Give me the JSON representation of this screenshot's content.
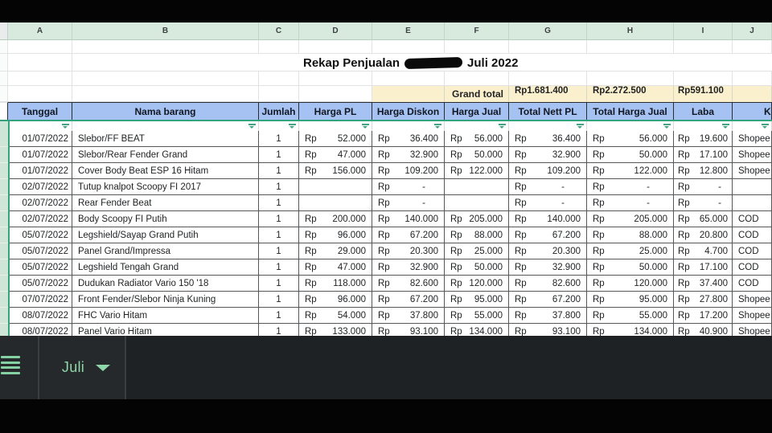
{
  "sheet": {
    "column_letters": [
      "A",
      "B",
      "C",
      "D",
      "E",
      "F",
      "G",
      "H",
      "I",
      "J"
    ],
    "title_prefix": "Rekap Penjualan",
    "title_suffix": "Juli 2022",
    "currency": "Rp",
    "grand_total": {
      "label": "Grand total",
      "total_nett_pl": "1.681.400",
      "total_harga_jual": "2.272.500",
      "laba": "591.100"
    },
    "headers": [
      "Tanggal",
      "Nama barang",
      "Jumlah",
      "Harga PL",
      "Harga Diskon",
      "Harga Jual",
      "Total Nett PL",
      "Total Harga Jual",
      "Laba",
      "Keterangan"
    ],
    "rows": [
      {
        "tanggal": "01/07/2022",
        "nama_barang": "Slebor/FF BEAT",
        "jumlah": "1",
        "harga_pl": "52.000",
        "harga_diskon": "36.400",
        "harga_jual": "56.000",
        "total_nett_pl": "36.400",
        "total_harga_jual": "56.000",
        "laba": "19.600",
        "keterangan": "Shopee"
      },
      {
        "tanggal": "01/07/2022",
        "nama_barang": "Slebor/Rear Fender Grand",
        "jumlah": "1",
        "harga_pl": "47.000",
        "harga_diskon": "32.900",
        "harga_jual": "50.000",
        "total_nett_pl": "32.900",
        "total_harga_jual": "50.000",
        "laba": "17.100",
        "keterangan": "Shopee"
      },
      {
        "tanggal": "01/07/2022",
        "nama_barang": "Cover Body Beat ESP 16 Hitam",
        "jumlah": "1",
        "harga_pl": "156.000",
        "harga_diskon": "109.200",
        "harga_jual": "122.000",
        "total_nett_pl": "109.200",
        "total_harga_jual": "122.000",
        "laba": "12.800",
        "keterangan": "Shopee"
      },
      {
        "tanggal": "02/07/2022",
        "nama_barang": "Tutup knalpot Scoopy FI 2017",
        "jumlah": "1",
        "harga_pl": "",
        "harga_diskon": "-",
        "harga_jual": "",
        "total_nett_pl": "-",
        "total_harga_jual": "-",
        "laba": "-",
        "keterangan": ""
      },
      {
        "tanggal": "02/07/2022",
        "nama_barang": "Rear Fender Beat",
        "jumlah": "1",
        "harga_pl": "",
        "harga_diskon": "-",
        "harga_jual": "",
        "total_nett_pl": "-",
        "total_harga_jual": "-",
        "laba": "-",
        "keterangan": ""
      },
      {
        "tanggal": "02/07/2022",
        "nama_barang": "Body Scoopy FI Putih",
        "jumlah": "1",
        "harga_pl": "200.000",
        "harga_diskon": "140.000",
        "harga_jual": "205.000",
        "total_nett_pl": "140.000",
        "total_harga_jual": "205.000",
        "laba": "65.000",
        "keterangan": "COD"
      },
      {
        "tanggal": "05/07/2022",
        "nama_barang": "Legshield/Sayap Grand Putih",
        "jumlah": "1",
        "harga_pl": "96.000",
        "harga_diskon": "67.200",
        "harga_jual": "88.000",
        "total_nett_pl": "67.200",
        "total_harga_jual": "88.000",
        "laba": "20.800",
        "keterangan": "COD"
      },
      {
        "tanggal": "05/07/2022",
        "nama_barang": "Panel Grand/Impressa",
        "jumlah": "1",
        "harga_pl": "29.000",
        "harga_diskon": "20.300",
        "harga_jual": "25.000",
        "total_nett_pl": "20.300",
        "total_harga_jual": "25.000",
        "laba": "4.700",
        "keterangan": "COD"
      },
      {
        "tanggal": "05/07/2022",
        "nama_barang": "Legshield Tengah Grand",
        "jumlah": "1",
        "harga_pl": "47.000",
        "harga_diskon": "32.900",
        "harga_jual": "50.000",
        "total_nett_pl": "32.900",
        "total_harga_jual": "50.000",
        "laba": "17.100",
        "keterangan": "COD"
      },
      {
        "tanggal": "05/07/2022",
        "nama_barang": "Dudukan Radiator Vario 150 '18",
        "jumlah": "1",
        "harga_pl": "118.000",
        "harga_diskon": "82.600",
        "harga_jual": "120.000",
        "total_nett_pl": "82.600",
        "total_harga_jual": "120.000",
        "laba": "37.400",
        "keterangan": "COD"
      },
      {
        "tanggal": "07/07/2022",
        "nama_barang": "Front Fender/Slebor Ninja Kuning",
        "jumlah": "1",
        "harga_pl": "96.000",
        "harga_diskon": "67.200",
        "harga_jual": "95.000",
        "total_nett_pl": "67.200",
        "total_harga_jual": "95.000",
        "laba": "27.800",
        "keterangan": "Shopee"
      },
      {
        "tanggal": "08/07/2022",
        "nama_barang": "FHC Vario Hitam",
        "jumlah": "1",
        "harga_pl": "54.000",
        "harga_diskon": "37.800",
        "harga_jual": "55.000",
        "total_nett_pl": "37.800",
        "total_harga_jual": "55.000",
        "laba": "17.200",
        "keterangan": "Shopee"
      },
      {
        "tanggal": "08/07/2022",
        "nama_barang": "Panel Vario Hitam",
        "jumlah": "1",
        "harga_pl": "133.000",
        "harga_diskon": "93.100",
        "harga_jual": "134.000",
        "total_nett_pl": "93.100",
        "total_harga_jual": "134.000",
        "laba": "40.900",
        "keterangan": "Shopee"
      }
    ]
  },
  "bottom_bar": {
    "active_sheet_tab": "Juli"
  },
  "colors": {
    "header_fill": "#a5c2f2",
    "grand_total_fill": "#fbf0ce",
    "column_letters_fill": "#d8e9dd",
    "filter_range_border": "#35a27e",
    "tab_text": "#8fd6a8",
    "bar_background": "#26292b"
  }
}
